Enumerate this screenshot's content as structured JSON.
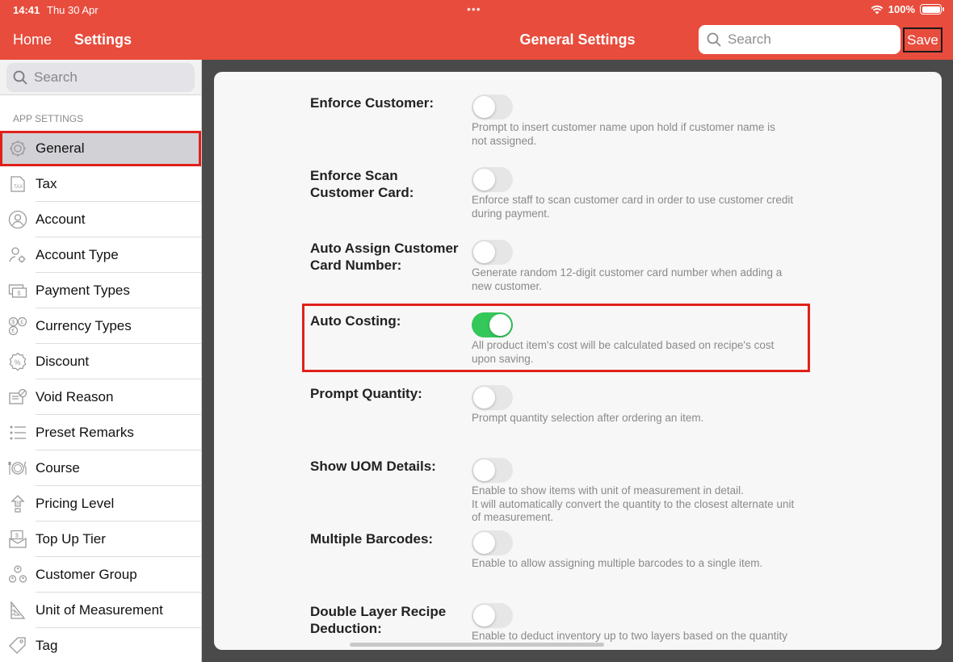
{
  "status": {
    "time": "14:41",
    "date": "Thu 30 Apr",
    "battery": "100%"
  },
  "nav": {
    "home": "Home",
    "settings": "Settings",
    "title": "General Settings",
    "search_placeholder": "Search",
    "save": "Save"
  },
  "sidebar": {
    "search_placeholder": "Search",
    "section": "APP SETTINGS",
    "items": [
      {
        "label": "General",
        "icon": "gear-icon"
      },
      {
        "label": "Tax",
        "icon": "tax-icon"
      },
      {
        "label": "Account",
        "icon": "user-icon"
      },
      {
        "label": "Account Type",
        "icon": "user-gear-icon"
      },
      {
        "label": "Payment Types",
        "icon": "payment-icon"
      },
      {
        "label": "Currency Types",
        "icon": "currency-icon"
      },
      {
        "label": "Discount",
        "icon": "discount-icon"
      },
      {
        "label": "Void Reason",
        "icon": "void-icon"
      },
      {
        "label": "Preset Remarks",
        "icon": "list-icon"
      },
      {
        "label": "Course",
        "icon": "cutlery-icon"
      },
      {
        "label": "Pricing Level",
        "icon": "pricing-icon"
      },
      {
        "label": "Top Up Tier",
        "icon": "topup-icon"
      },
      {
        "label": "Customer Group",
        "icon": "group-icon"
      },
      {
        "label": "Unit of Measurement",
        "icon": "ruler-icon"
      },
      {
        "label": "Tag",
        "icon": "tag-icon"
      }
    ]
  },
  "settings": [
    {
      "label": "Enforce Customer:",
      "on": false,
      "desc": "Prompt to insert customer name upon hold if customer name is\nnot assigned."
    },
    {
      "label": "Enforce Scan Customer Card:",
      "on": false,
      "desc": "Enforce staff to scan customer card in order to use customer credit\nduring payment."
    },
    {
      "label": "Auto Assign Customer Card Number:",
      "on": false,
      "desc": "Generate random 12-digit customer card number when adding a\nnew customer."
    },
    {
      "label": "Auto Costing:",
      "on": true,
      "desc": "All product item's cost will be calculated based on recipe's cost\nupon saving."
    },
    {
      "label": "Prompt Quantity:",
      "on": false,
      "desc": "Prompt quantity selection after ordering an item."
    },
    {
      "label": "Show UOM Details:",
      "on": false,
      "desc": "Enable to show items with unit of measurement in detail.\nIt will automatically convert the quantity to the closest alternate unit\nof measurement."
    },
    {
      "label": "Multiple Barcodes:",
      "on": false,
      "desc": "Enable to allow assigning multiple barcodes to a single item."
    },
    {
      "label": "Double Layer Recipe Deduction:",
      "on": false,
      "desc": "Enable to deduct inventory up to two layers based on the quantity"
    }
  ]
}
